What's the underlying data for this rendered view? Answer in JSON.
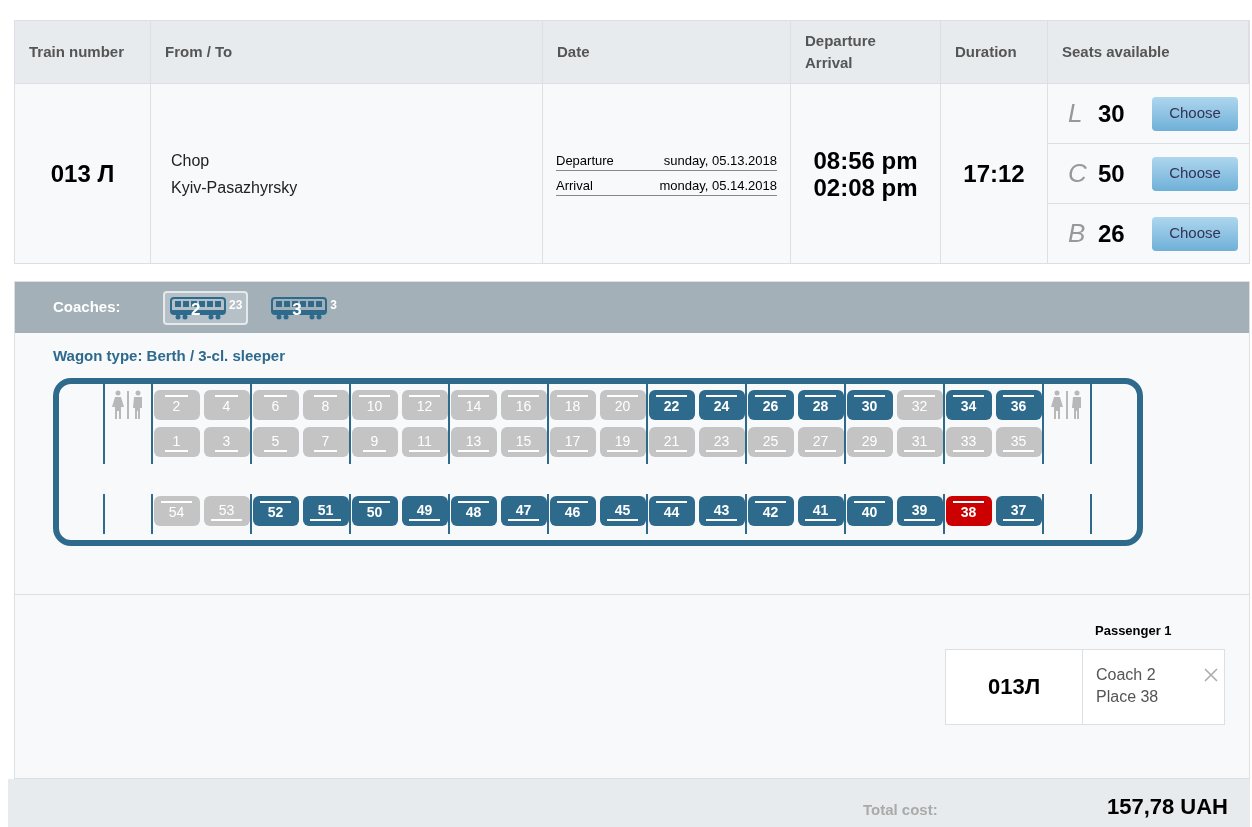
{
  "table": {
    "columns": [
      "Train number",
      "From / To",
      "Date",
      "Departure\nArrival",
      "Duration",
      "Seats available"
    ],
    "row": {
      "train_number": "013 Л",
      "from": "Chop",
      "to": "Kyiv-Pasazhyrsky",
      "dates": [
        {
          "label": "Departure",
          "value": "sunday, 05.13.2018"
        },
        {
          "label": "Arrival",
          "value": "monday, 05.14.2018"
        }
      ],
      "departure_time": "08:56 pm",
      "arrival_time": "02:08 pm",
      "duration": "17:12",
      "seats": [
        {
          "class": "L",
          "count": "30",
          "button": "Choose"
        },
        {
          "class": "C",
          "count": "50",
          "button": "Choose"
        },
        {
          "class": "B",
          "count": "26",
          "button": "Choose"
        }
      ]
    }
  },
  "coaches": {
    "label": "Coaches:",
    "items": [
      {
        "number": "2",
        "free": "23",
        "selected": true
      },
      {
        "number": "3",
        "free": "3",
        "selected": false
      }
    ]
  },
  "wagon_type": "Wagon type: Berth / 3-cl. sleeper",
  "compartments": [
    {
      "top": [
        {
          "n": "2",
          "kind": "upper",
          "available": false,
          "selected": false
        },
        {
          "n": "4",
          "kind": "upper",
          "available": false,
          "selected": false
        }
      ],
      "bottom": [
        {
          "n": "1",
          "kind": "lower",
          "available": false,
          "selected": false
        },
        {
          "n": "3",
          "kind": "lower",
          "available": false,
          "selected": false
        }
      ],
      "side": [
        {
          "n": "54",
          "kind": "upper",
          "available": false,
          "selected": false
        },
        {
          "n": "53",
          "kind": "lower",
          "available": false,
          "selected": false
        }
      ]
    },
    {
      "top": [
        {
          "n": "6",
          "kind": "upper",
          "available": false,
          "selected": false
        },
        {
          "n": "8",
          "kind": "upper",
          "available": false,
          "selected": false
        }
      ],
      "bottom": [
        {
          "n": "5",
          "kind": "lower",
          "available": false,
          "selected": false
        },
        {
          "n": "7",
          "kind": "lower",
          "available": false,
          "selected": false
        }
      ],
      "side": [
        {
          "n": "52",
          "kind": "upper",
          "available": true,
          "selected": false
        },
        {
          "n": "51",
          "kind": "lower",
          "available": true,
          "selected": false
        }
      ]
    },
    {
      "top": [
        {
          "n": "10",
          "kind": "upper",
          "available": false,
          "selected": false
        },
        {
          "n": "12",
          "kind": "upper",
          "available": false,
          "selected": false
        }
      ],
      "bottom": [
        {
          "n": "9",
          "kind": "lower",
          "available": false,
          "selected": false
        },
        {
          "n": "11",
          "kind": "lower",
          "available": false,
          "selected": false
        }
      ],
      "side": [
        {
          "n": "50",
          "kind": "upper",
          "available": true,
          "selected": false
        },
        {
          "n": "49",
          "kind": "lower",
          "available": true,
          "selected": false
        }
      ]
    },
    {
      "top": [
        {
          "n": "14",
          "kind": "upper",
          "available": false,
          "selected": false
        },
        {
          "n": "16",
          "kind": "upper",
          "available": false,
          "selected": false
        }
      ],
      "bottom": [
        {
          "n": "13",
          "kind": "lower",
          "available": false,
          "selected": false
        },
        {
          "n": "15",
          "kind": "lower",
          "available": false,
          "selected": false
        }
      ],
      "side": [
        {
          "n": "48",
          "kind": "upper",
          "available": true,
          "selected": false
        },
        {
          "n": "47",
          "kind": "lower",
          "available": true,
          "selected": false
        }
      ]
    },
    {
      "top": [
        {
          "n": "18",
          "kind": "upper",
          "available": false,
          "selected": false
        },
        {
          "n": "20",
          "kind": "upper",
          "available": false,
          "selected": false
        }
      ],
      "bottom": [
        {
          "n": "17",
          "kind": "lower",
          "available": false,
          "selected": false
        },
        {
          "n": "19",
          "kind": "lower",
          "available": false,
          "selected": false
        }
      ],
      "side": [
        {
          "n": "46",
          "kind": "upper",
          "available": true,
          "selected": false
        },
        {
          "n": "45",
          "kind": "lower",
          "available": true,
          "selected": false
        }
      ]
    },
    {
      "top": [
        {
          "n": "22",
          "kind": "upper",
          "available": true,
          "selected": false
        },
        {
          "n": "24",
          "kind": "upper",
          "available": true,
          "selected": false
        }
      ],
      "bottom": [
        {
          "n": "21",
          "kind": "lower",
          "available": false,
          "selected": false
        },
        {
          "n": "23",
          "kind": "lower",
          "available": false,
          "selected": false
        }
      ],
      "side": [
        {
          "n": "44",
          "kind": "upper",
          "available": true,
          "selected": false
        },
        {
          "n": "43",
          "kind": "lower",
          "available": true,
          "selected": false
        }
      ]
    },
    {
      "top": [
        {
          "n": "26",
          "kind": "upper",
          "available": true,
          "selected": false
        },
        {
          "n": "28",
          "kind": "upper",
          "available": true,
          "selected": false
        }
      ],
      "bottom": [
        {
          "n": "25",
          "kind": "lower",
          "available": false,
          "selected": false
        },
        {
          "n": "27",
          "kind": "lower",
          "available": false,
          "selected": false
        }
      ],
      "side": [
        {
          "n": "42",
          "kind": "upper",
          "available": true,
          "selected": false
        },
        {
          "n": "41",
          "kind": "lower",
          "available": true,
          "selected": false
        }
      ]
    },
    {
      "top": [
        {
          "n": "30",
          "kind": "upper",
          "available": true,
          "selected": false
        },
        {
          "n": "32",
          "kind": "upper",
          "available": false,
          "selected": false
        }
      ],
      "bottom": [
        {
          "n": "29",
          "kind": "lower",
          "available": false,
          "selected": false
        },
        {
          "n": "31",
          "kind": "lower",
          "available": false,
          "selected": false
        }
      ],
      "side": [
        {
          "n": "40",
          "kind": "upper",
          "available": true,
          "selected": false
        },
        {
          "n": "39",
          "kind": "lower",
          "available": true,
          "selected": false
        }
      ]
    },
    {
      "top": [
        {
          "n": "34",
          "kind": "upper",
          "available": true,
          "selected": false
        },
        {
          "n": "36",
          "kind": "upper",
          "available": true,
          "selected": false
        }
      ],
      "bottom": [
        {
          "n": "33",
          "kind": "lower",
          "available": false,
          "selected": false
        },
        {
          "n": "35",
          "kind": "lower",
          "available": false,
          "selected": false
        }
      ],
      "side": [
        {
          "n": "38",
          "kind": "upper",
          "available": true,
          "selected": true
        },
        {
          "n": "37",
          "kind": "lower",
          "available": true,
          "selected": false
        }
      ]
    }
  ],
  "passenger": {
    "title": "Passenger 1",
    "train": "013Л",
    "coach": "Coach 2",
    "place": "Place 38"
  },
  "total": {
    "label": "Total cost:",
    "value": "157,78 UAH"
  }
}
